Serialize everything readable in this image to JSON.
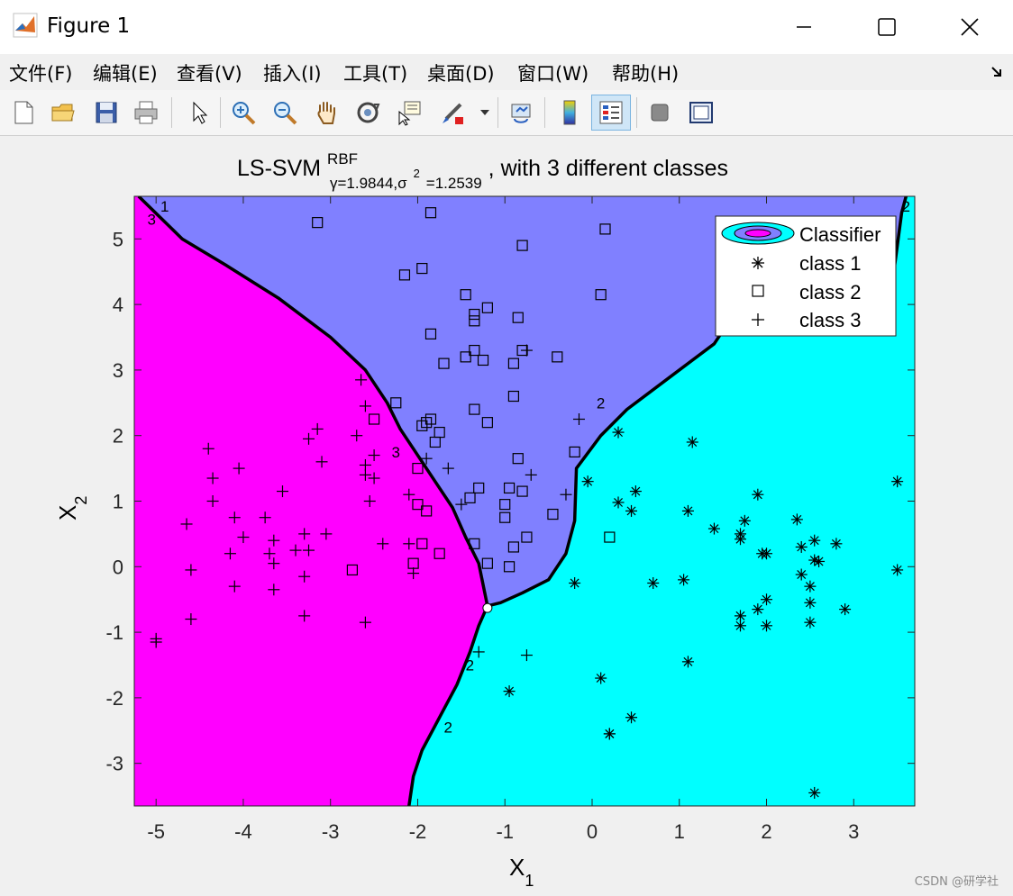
{
  "window": {
    "title": "Figure 1"
  },
  "menu": [
    {
      "label": "文件(F)"
    },
    {
      "label": "编辑(E)"
    },
    {
      "label": "查看(V)"
    },
    {
      "label": "插入(I)"
    },
    {
      "label": "工具(T)"
    },
    {
      "label": "桌面(D)"
    },
    {
      "label": "窗口(W)"
    },
    {
      "label": "帮助(H)"
    }
  ],
  "toolbar_icons": [
    "new-file-icon",
    "open-folder-icon",
    "save-icon",
    "print-icon",
    "pointer-icon",
    "zoom-in-icon",
    "zoom-out-icon",
    "pan-hand-icon",
    "rotate-3d-icon",
    "data-cursor-icon",
    "brush-icon",
    "link-plot-icon",
    "colorbar-icon",
    "legend-icon",
    "hide-plot-tools-icon",
    "show-plot-tools-icon"
  ],
  "colors": {
    "class1_region": "#00ffff",
    "class2_region": "#8080ff",
    "class3_region": "#ff00ff",
    "boundary": "#000000"
  },
  "chart_data": {
    "type": "scatter",
    "title": "LS-SVM",
    "title_sup": "RBF",
    "title_sub": "γ=1.9844,σ",
    "title_sub_sup": "2",
    "title_sub_rest": "=1.2539",
    "title_rest": ", with 3 different classes",
    "xlabel": "X",
    "xlabel_sub": "1",
    "ylabel": "X",
    "ylabel_sub": "2",
    "xlim": [
      -5.25,
      3.7
    ],
    "ylim": [
      -3.65,
      5.65
    ],
    "xticks": [
      "-5",
      "-4",
      "-3",
      "-2",
      "-1",
      "0",
      "1",
      "2",
      "3"
    ],
    "yticks": [
      "-3",
      "-2",
      "-1",
      "0",
      "1",
      "2",
      "3",
      "4",
      "5"
    ],
    "contour_labels": [
      "3",
      "3",
      "2",
      "2",
      "2",
      "2",
      "1"
    ],
    "legend": {
      "location": "top-right",
      "entries": [
        {
          "label": "Classifier",
          "marker": "ellipse"
        },
        {
          "label": "class 1",
          "marker": "*"
        },
        {
          "label": "class 2",
          "marker": "square"
        },
        {
          "label": "class 3",
          "marker": "+"
        }
      ]
    },
    "regions": [
      {
        "class": 2,
        "color": "#8080ff",
        "polygon": [
          [
            -5.2,
            5.65
          ],
          [
            -4.7,
            5.0
          ],
          [
            -4.2,
            4.6
          ],
          [
            -3.6,
            4.1
          ],
          [
            -3.0,
            3.5
          ],
          [
            -2.6,
            3.0
          ],
          [
            -2.35,
            2.5
          ],
          [
            -2.2,
            2.1
          ],
          [
            -2.0,
            1.7
          ],
          [
            -1.8,
            1.3
          ],
          [
            -1.6,
            0.9
          ],
          [
            -1.45,
            0.45
          ],
          [
            -1.3,
            0.05
          ],
          [
            -1.2,
            -0.6
          ],
          [
            -1.05,
            -0.55
          ],
          [
            -0.8,
            -0.4
          ],
          [
            -0.5,
            -0.2
          ],
          [
            -0.3,
            0.2
          ],
          [
            -0.2,
            0.7
          ],
          [
            -0.18,
            1.5
          ],
          [
            0.1,
            2.0
          ],
          [
            0.4,
            2.4
          ],
          [
            0.9,
            2.9
          ],
          [
            1.4,
            3.4
          ],
          [
            1.6,
            3.8
          ],
          [
            3.4,
            3.9
          ],
          [
            3.55,
            5.4
          ],
          [
            3.6,
            5.65
          ]
        ]
      },
      {
        "class": 3,
        "color": "#ff00ff",
        "polygon": [
          [
            -5.25,
            5.65
          ],
          [
            -5.2,
            5.65
          ],
          [
            -4.7,
            5.0
          ],
          [
            -4.2,
            4.6
          ],
          [
            -3.6,
            4.1
          ],
          [
            -3.0,
            3.5
          ],
          [
            -2.6,
            3.0
          ],
          [
            -2.35,
            2.5
          ],
          [
            -2.2,
            2.1
          ],
          [
            -2.0,
            1.7
          ],
          [
            -1.8,
            1.3
          ],
          [
            -1.6,
            0.9
          ],
          [
            -1.45,
            0.45
          ],
          [
            -1.3,
            0.05
          ],
          [
            -1.2,
            -0.6
          ],
          [
            -1.3,
            -0.9
          ],
          [
            -1.4,
            -1.3
          ],
          [
            -1.55,
            -1.8
          ],
          [
            -1.75,
            -2.3
          ],
          [
            -1.95,
            -2.8
          ],
          [
            -2.05,
            -3.2
          ],
          [
            -2.1,
            -3.65
          ],
          [
            -5.25,
            -3.65
          ]
        ]
      }
    ],
    "boundary_lines": [
      [
        [
          -5.2,
          5.65
        ],
        [
          -4.7,
          5.0
        ],
        [
          -4.2,
          4.6
        ],
        [
          -3.6,
          4.1
        ],
        [
          -3.0,
          3.5
        ],
        [
          -2.6,
          3.0
        ],
        [
          -2.35,
          2.5
        ],
        [
          -2.2,
          2.1
        ],
        [
          -2.0,
          1.7
        ],
        [
          -1.8,
          1.3
        ],
        [
          -1.6,
          0.9
        ],
        [
          -1.45,
          0.45
        ],
        [
          -1.3,
          0.05
        ],
        [
          -1.2,
          -0.6
        ]
      ],
      [
        [
          -1.2,
          -0.6
        ],
        [
          -1.3,
          -0.9
        ],
        [
          -1.4,
          -1.3
        ],
        [
          -1.55,
          -1.8
        ],
        [
          -1.75,
          -2.3
        ],
        [
          -1.95,
          -2.8
        ],
        [
          -2.05,
          -3.2
        ],
        [
          -2.1,
          -3.65
        ]
      ],
      [
        [
          -1.2,
          -0.6
        ],
        [
          -1.05,
          -0.55
        ],
        [
          -0.8,
          -0.4
        ],
        [
          -0.5,
          -0.2
        ],
        [
          -0.3,
          0.2
        ],
        [
          -0.2,
          0.7
        ],
        [
          -0.18,
          1.5
        ],
        [
          0.1,
          2.0
        ],
        [
          0.4,
          2.4
        ],
        [
          0.9,
          2.9
        ],
        [
          1.4,
          3.4
        ],
        [
          1.6,
          3.8
        ],
        [
          3.4,
          3.9
        ],
        [
          3.55,
          5.4
        ],
        [
          3.6,
          5.65
        ]
      ]
    ],
    "series": [
      {
        "name": "class 1",
        "marker": "*",
        "points": [
          [
            0.3,
            2.05
          ],
          [
            1.15,
            1.9
          ],
          [
            3.5,
            1.3
          ],
          [
            -0.05,
            1.3
          ],
          [
            0.5,
            1.15
          ],
          [
            0.3,
            0.98
          ],
          [
            1.9,
            1.1
          ],
          [
            0.45,
            0.85
          ],
          [
            1.1,
            0.85
          ],
          [
            1.75,
            0.7
          ],
          [
            2.35,
            0.72
          ],
          [
            1.4,
            0.58
          ],
          [
            1.7,
            0.5
          ],
          [
            1.7,
            0.42
          ],
          [
            2.55,
            0.4
          ],
          [
            2.8,
            0.35
          ],
          [
            2.4,
            0.3
          ],
          [
            1.95,
            0.2
          ],
          [
            2.0,
            0.2
          ],
          [
            2.55,
            0.1
          ],
          [
            2.6,
            0.08
          ],
          [
            3.5,
            -0.05
          ],
          [
            2.4,
            -0.12
          ],
          [
            0.7,
            -0.25
          ],
          [
            1.05,
            -0.2
          ],
          [
            -0.2,
            -0.25
          ],
          [
            2.5,
            -0.3
          ],
          [
            2.0,
            -0.5
          ],
          [
            2.5,
            -0.55
          ],
          [
            1.9,
            -0.65
          ],
          [
            2.9,
            -0.65
          ],
          [
            1.7,
            -0.75
          ],
          [
            1.7,
            -0.9
          ],
          [
            2.0,
            -0.9
          ],
          [
            2.5,
            -0.85
          ],
          [
            1.1,
            -1.45
          ],
          [
            0.1,
            -1.7
          ],
          [
            -0.95,
            -1.9
          ],
          [
            0.45,
            -2.3
          ],
          [
            0.2,
            -2.55
          ],
          [
            0.2,
            -2.55
          ],
          [
            2.55,
            -3.45
          ]
        ]
      },
      {
        "name": "class 2",
        "marker": "square",
        "points": [
          [
            -3.15,
            5.25
          ],
          [
            -1.85,
            5.4
          ],
          [
            0.15,
            5.15
          ],
          [
            -0.8,
            4.9
          ],
          [
            -1.95,
            4.55
          ],
          [
            -2.15,
            4.45
          ],
          [
            0.1,
            4.15
          ],
          [
            -1.45,
            4.15
          ],
          [
            -1.2,
            3.95
          ],
          [
            -1.35,
            3.85
          ],
          [
            -1.35,
            3.75
          ],
          [
            -0.85,
            3.8
          ],
          [
            -1.85,
            3.55
          ],
          [
            -1.35,
            3.3
          ],
          [
            -0.8,
            3.3
          ],
          [
            -1.7,
            3.1
          ],
          [
            -1.45,
            3.2
          ],
          [
            -1.25,
            3.15
          ],
          [
            -0.9,
            3.1
          ],
          [
            -0.4,
            3.2
          ],
          [
            -2.25,
            2.5
          ],
          [
            -0.9,
            2.6
          ],
          [
            -2.5,
            2.25
          ],
          [
            -1.35,
            2.4
          ],
          [
            -1.9,
            2.2
          ],
          [
            -1.95,
            2.15
          ],
          [
            -1.85,
            2.25
          ],
          [
            -1.75,
            2.05
          ],
          [
            -1.2,
            2.2
          ],
          [
            -1.8,
            1.9
          ],
          [
            -2.0,
            1.5
          ],
          [
            -0.85,
            1.65
          ],
          [
            -0.2,
            1.75
          ],
          [
            -1.3,
            1.2
          ],
          [
            -1.4,
            1.05
          ],
          [
            -0.95,
            1.2
          ],
          [
            -0.8,
            1.15
          ],
          [
            -1.0,
            0.95
          ],
          [
            -2.0,
            0.95
          ],
          [
            -1.9,
            0.85
          ],
          [
            -0.45,
            0.8
          ],
          [
            -1.0,
            0.75
          ],
          [
            -0.75,
            0.45
          ],
          [
            -1.35,
            0.35
          ],
          [
            -0.9,
            0.3
          ],
          [
            0.2,
            0.45
          ],
          [
            -1.95,
            0.35
          ],
          [
            -1.75,
            0.2
          ],
          [
            -1.2,
            0.05
          ],
          [
            -0.95,
            0.0
          ],
          [
            -2.05,
            0.05
          ],
          [
            -2.75,
            -0.05
          ]
        ]
      },
      {
        "name": "class 3",
        "marker": "+",
        "points": [
          [
            -2.65,
            2.85
          ],
          [
            -0.75,
            3.3
          ],
          [
            -2.6,
            2.45
          ],
          [
            -0.15,
            2.25
          ],
          [
            -3.15,
            2.1
          ],
          [
            -3.25,
            1.95
          ],
          [
            -2.7,
            2.0
          ],
          [
            -4.4,
            1.8
          ],
          [
            -2.5,
            1.7
          ],
          [
            -2.6,
            1.55
          ],
          [
            -3.1,
            1.6
          ],
          [
            -1.9,
            1.65
          ],
          [
            -2.6,
            1.4
          ],
          [
            -1.65,
            1.5
          ],
          [
            -4.05,
            1.5
          ],
          [
            -4.35,
            1.35
          ],
          [
            -0.7,
            1.4
          ],
          [
            -2.5,
            1.35
          ],
          [
            -3.55,
            1.15
          ],
          [
            -2.1,
            1.1
          ],
          [
            -4.35,
            1.0
          ],
          [
            -2.55,
            1.0
          ],
          [
            -1.5,
            0.95
          ],
          [
            -0.3,
            1.1
          ],
          [
            -4.65,
            0.65
          ],
          [
            -4.1,
            0.75
          ],
          [
            -3.75,
            0.75
          ],
          [
            -4.0,
            0.45
          ],
          [
            -3.3,
            0.5
          ],
          [
            -3.05,
            0.5
          ],
          [
            -3.4,
            0.25
          ],
          [
            -3.25,
            0.25
          ],
          [
            -2.4,
            0.35
          ],
          [
            -2.1,
            0.35
          ],
          [
            -3.7,
            0.2
          ],
          [
            -4.15,
            0.2
          ],
          [
            -3.65,
            0.4
          ],
          [
            -4.6,
            -0.05
          ],
          [
            -3.65,
            0.05
          ],
          [
            -3.3,
            -0.15
          ],
          [
            -2.05,
            -0.1
          ],
          [
            -4.1,
            -0.3
          ],
          [
            -3.65,
            -0.35
          ],
          [
            -3.3,
            -0.75
          ],
          [
            -2.6,
            -0.85
          ],
          [
            -4.6,
            -0.8
          ],
          [
            -5.0,
            -1.1
          ],
          [
            -5.0,
            -1.15
          ],
          [
            -1.3,
            -1.3
          ],
          [
            -0.75,
            -1.35
          ]
        ]
      }
    ]
  },
  "watermark": "CSDN @研学社"
}
